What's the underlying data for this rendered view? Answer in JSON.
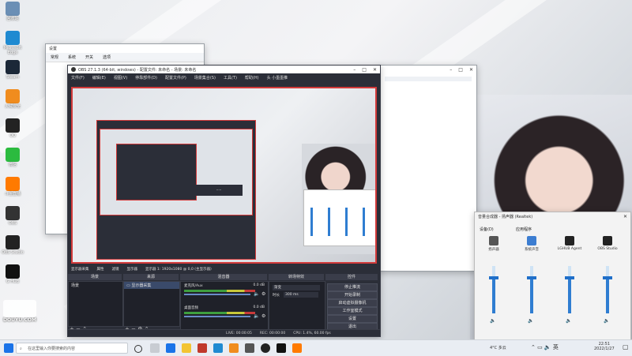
{
  "desktop": {
    "icons": [
      {
        "label": "回收站",
        "color": "#6b8fb5"
      },
      {
        "label": "Microsoft Edge",
        "color": "#1f8ad1"
      },
      {
        "label": "Steam",
        "color": "#1b2838"
      },
      {
        "label": "火绒安全",
        "color": "#f08c1e"
      },
      {
        "label": "QQ",
        "color": "#222"
      },
      {
        "label": "微信",
        "color": "#2bbb3f"
      },
      {
        "label": "斗鱼直播",
        "color": "#ff7a00"
      },
      {
        "label": "OBS",
        "color": "#333"
      },
      {
        "label": "OBS Studio",
        "color": "#222"
      },
      {
        "label": "G HUB",
        "color": "#111"
      }
    ]
  },
  "settings_window": {
    "title": "设置",
    "tabs": [
      "常规",
      "系统",
      "开关",
      "选项"
    ]
  },
  "obs": {
    "title": "OBS 27.1.3 (64-bit, windows) - 配置文件: 未命名 - 场景: 未命名",
    "menu": [
      "文件(F)",
      "编辑(E)",
      "视图(V)",
      "停靠部件(D)",
      "配置文件(P)",
      "场景集合(S)",
      "工具(T)",
      "帮助(H)",
      "头 小墨墨推"
    ],
    "source_tab": "显示器采集",
    "props_label": "属性",
    "filters_label": "滤镜",
    "display_label": "显示器",
    "display_value": "显示器 1: 1920x1080 @ 0,0 (主显示器)",
    "docks": {
      "scenes": "场景",
      "sources": "来源",
      "mixer": "混音器",
      "transitions": "转场特效",
      "controls": "控件"
    },
    "scene_item": "场景",
    "source_item": "显示器采集",
    "mixer_tracks": [
      {
        "name": "麦克风/Aux",
        "db": "0.0 dB"
      },
      {
        "name": "桌面音频",
        "db": "0.0 dB"
      }
    ],
    "transition_value": "渐变",
    "duration_label": "时长",
    "duration_value": "300 ms",
    "controls_buttons": [
      "停止推流",
      "开始录制",
      "启动虚拟摄像机",
      "工作室模式",
      "设置",
      "退出"
    ],
    "status": {
      "live": "LIVE: 00:00:05",
      "rec": "REC: 00:00:00",
      "cpu": "CPU: 1.4%, 60.00 fps"
    }
  },
  "explorer_window": {
    "title": ""
  },
  "mixer_window": {
    "title": "音量合成器 - 扬声器 (Realtek)",
    "device_label": "设备(D)",
    "apps_label": "应用程序",
    "columns": [
      {
        "name": "扬声器",
        "color": "#555",
        "level": 0.75
      },
      {
        "name": "系统声音",
        "color": "#3c7dd1",
        "level": 0.75
      },
      {
        "name": "LGHUB Agent",
        "color": "#222",
        "level": 0.75
      },
      {
        "name": "OBS Studio",
        "color": "#222",
        "level": 0.75
      }
    ]
  },
  "taskbar": {
    "search_placeholder": "在这里输入你要搜索的内容",
    "weather": "4°C 多云",
    "time": "22:51",
    "date": "2022/1/27"
  },
  "watermark": {
    "text": "DOUYU.COM"
  }
}
